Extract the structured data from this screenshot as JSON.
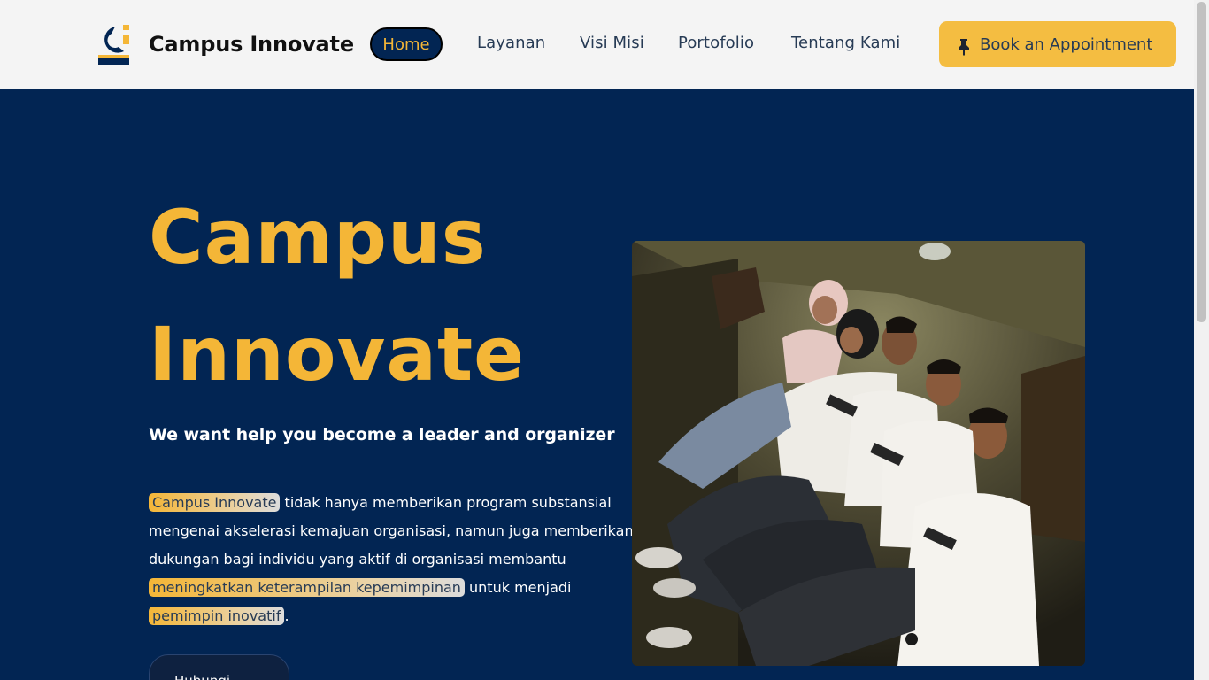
{
  "header": {
    "brand": "Campus Innovate",
    "nav": [
      "Home",
      "Layanan",
      "Visi Misi",
      "Portofolio",
      "Tentang Kami"
    ],
    "active_nav": "Home",
    "cta_label": "Book an Appointment",
    "cta_icon": "pin-icon"
  },
  "hero": {
    "title_line1": "Campus",
    "title_line2": "Innovate",
    "tagline": "We want help you become a leader and organizer",
    "para": {
      "hl1": "Campus Innovate",
      "t1": " tidak hanya memberikan program substansial mengenai akselerasi kemajuan organisasi, namun juga memberikan dukungan bagi individu yang aktif di organisasi membantu ",
      "hl2": "meningkatkan keterampilan kepemimpinan",
      "t2": " untuk menjadi ",
      "hl3": "pemimpin inovatif",
      "t3": "."
    },
    "cta": "Hubungi Kami"
  },
  "colors": {
    "navy": "#022553",
    "gold": "#f4b637",
    "nav_text": "#273b55"
  }
}
